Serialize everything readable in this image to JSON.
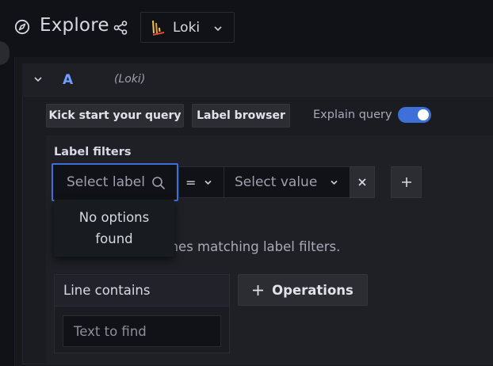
{
  "header": {
    "title": "Explore",
    "datasource": "Loki"
  },
  "query_row": {
    "name": "A",
    "datasource_hint": "(Loki)",
    "kick_start_label": "Kick start your query",
    "label_browser_label": "Label browser",
    "explain_query_label": "Explain query",
    "explain_query_enabled": true
  },
  "builder": {
    "label_filters_title": "Label filters",
    "select_label_placeholder": "Select label",
    "operator": "=",
    "select_value_placeholder": "Select value",
    "dropdown_message": "No options found",
    "hint_partial": "ines matching label filters.",
    "line_contains_title": "Line contains",
    "text_to_find_placeholder": "Text to find",
    "operations_label": "Operations"
  },
  "colors": {
    "accent": "#3d71d9",
    "query_name": "#6e9fff",
    "background": "#111217"
  }
}
